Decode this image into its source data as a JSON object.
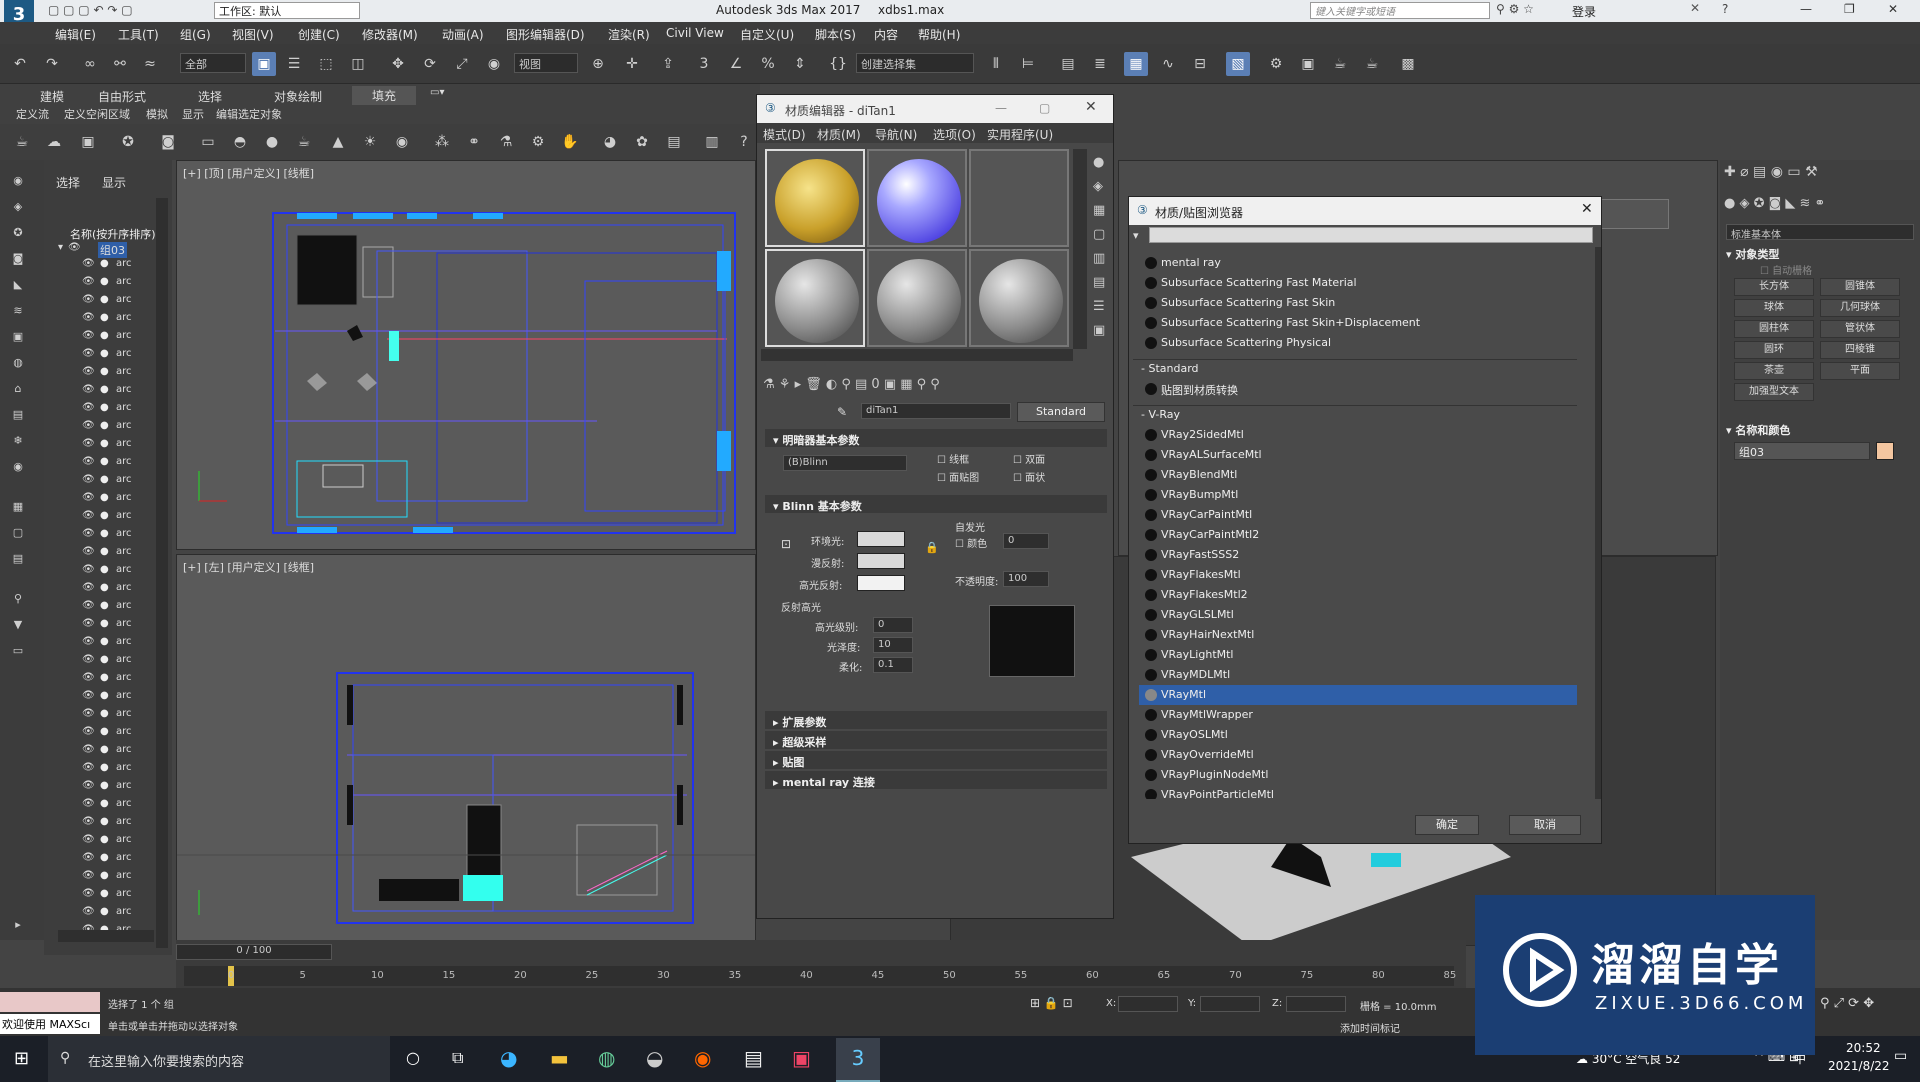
{
  "titlebar": {
    "workspace": "工作区: 默认",
    "app_title": "Autodesk 3ds Max 2017",
    "file_name": "xdbs1.max",
    "search_placeholder": "键入关键字或短语",
    "login": "登录"
  },
  "menu": [
    "编辑(E)",
    "工具(T)",
    "组(G)",
    "视图(V)",
    "创建(C)",
    "修改器(M)",
    "动画(A)",
    "图形编辑器(D)",
    "渲染(R)",
    "Civil View",
    "自定义(U)",
    "脚本(S)",
    "内容",
    "帮助(H)"
  ],
  "toolbar": {
    "filter": "全部",
    "view_dropdown": "视图",
    "selection_set": "创建选择集"
  },
  "ribbon": {
    "tabs": [
      "建模",
      "自由形式",
      "选择",
      "对象绘制",
      "填充"
    ],
    "subtabs": [
      "定义流",
      "定义空闲区域",
      "模拟",
      "显示",
      "编辑选定对象"
    ]
  },
  "scene_explorer": {
    "tabs": [
      "选择",
      "显示"
    ],
    "header": "名称(按升序排序)",
    "group": "组03",
    "item_prefix": "arc"
  },
  "viewports": {
    "top_label": "[+] [顶] [用户定义] [线框]",
    "left_label": "[+] [左] [用户定义] [线框]"
  },
  "material_editor": {
    "title": "材质编辑器 - diTan1",
    "menu": [
      "模式(D)",
      "材质(M)",
      "导航(N)",
      "选项(O)",
      "实用程序(U)"
    ],
    "material_name": "diTan1",
    "material_type": "Standard",
    "shader_rollout": "明暗器基本参数",
    "shader": "(B)Blinn",
    "shader_checks": [
      "线框",
      "双面",
      "面贴图",
      "面状"
    ],
    "blinn_rollout": "Blinn 基本参数",
    "self_illum": "自发光",
    "color_label": "颜色",
    "color_value": "0",
    "ambient": "环境光:",
    "diffuse": "漫反射:",
    "specular": "高光反射:",
    "opacity_label": "不透明度:",
    "opacity_value": "100",
    "spec_highlights": "反射高光",
    "spec_level_label": "高光级别:",
    "spec_level": "0",
    "gloss_label": "光泽度:",
    "gloss": "10",
    "soften_label": "柔化:",
    "soften": "0.1",
    "rollouts": [
      "扩展参数",
      "超级采样",
      "贴图",
      "mental ray 连接"
    ]
  },
  "browser": {
    "title": "材质/贴图浏览器",
    "items_top": [
      "mental ray",
      "Subsurface Scattering Fast Material",
      "Subsurface Scattering Fast Skin",
      "Subsurface Scattering Fast Skin+Displacement",
      "Subsurface Scattering Physical"
    ],
    "group_standard": "- Standard",
    "standard_items": [
      "贴图到材质转换"
    ],
    "group_vray": "- V-Ray",
    "vray_items": [
      "VRay2SidedMtl",
      "VRayALSurfaceMtl",
      "VRayBlendMtl",
      "VRayBumpMtl",
      "VRayCarPaintMtl",
      "VRayCarPaintMtl2",
      "VRayFastSSS2",
      "VRayFlakesMtl",
      "VRayFlakesMtl2",
      "VRayGLSLMtl",
      "VRayHairNextMtl",
      "VRayLightMtl",
      "VRayMDLMtl",
      "VRayMtl",
      "VRayMtlWrapper",
      "VRayOSLMtl",
      "VRayOverrideMtl",
      "VRayPluginNodeMtl",
      "VRayPointParticleMtl"
    ],
    "selected": "VRayMtl",
    "ok": "确定",
    "cancel": "取消"
  },
  "command_panel": {
    "dropdown": "标准基本体",
    "object_type": "对象类型",
    "autogrid": "自动栅格",
    "buttons": [
      "长方体",
      "圆锥体",
      "球体",
      "几何球体",
      "圆柱体",
      "管状体",
      "圆环",
      "四棱锥",
      "茶壶",
      "平面",
      "加强型文本"
    ],
    "name_color": "名称和颜色",
    "object_name": "组03"
  },
  "timeline": {
    "frame": "0 / 100",
    "ticks": [
      "0",
      "5",
      "10",
      "15",
      "20",
      "25",
      "30",
      "35",
      "40",
      "45",
      "50",
      "55",
      "60",
      "65",
      "70",
      "75",
      "80",
      "85"
    ]
  },
  "status": {
    "selected": "选择了 1 个 组",
    "hint": "单击或单击并拖动以选择对象",
    "welcome": "欢迎使用 MAXScı",
    "x_label": "X:",
    "y_label": "Y:",
    "z_label": "Z:",
    "grid": "栅格 = 10.0mm",
    "add_time_tag": "添加时间标记"
  },
  "taskbar": {
    "search": "在这里输入你要搜索的内容",
    "weather": "30°C 空气良 52",
    "ime": "中",
    "time": "20:52",
    "date": "2021/8/22"
  },
  "watermark": {
    "brand": "溜溜自学",
    "url": "ZIXUE.3D66.COM"
  }
}
